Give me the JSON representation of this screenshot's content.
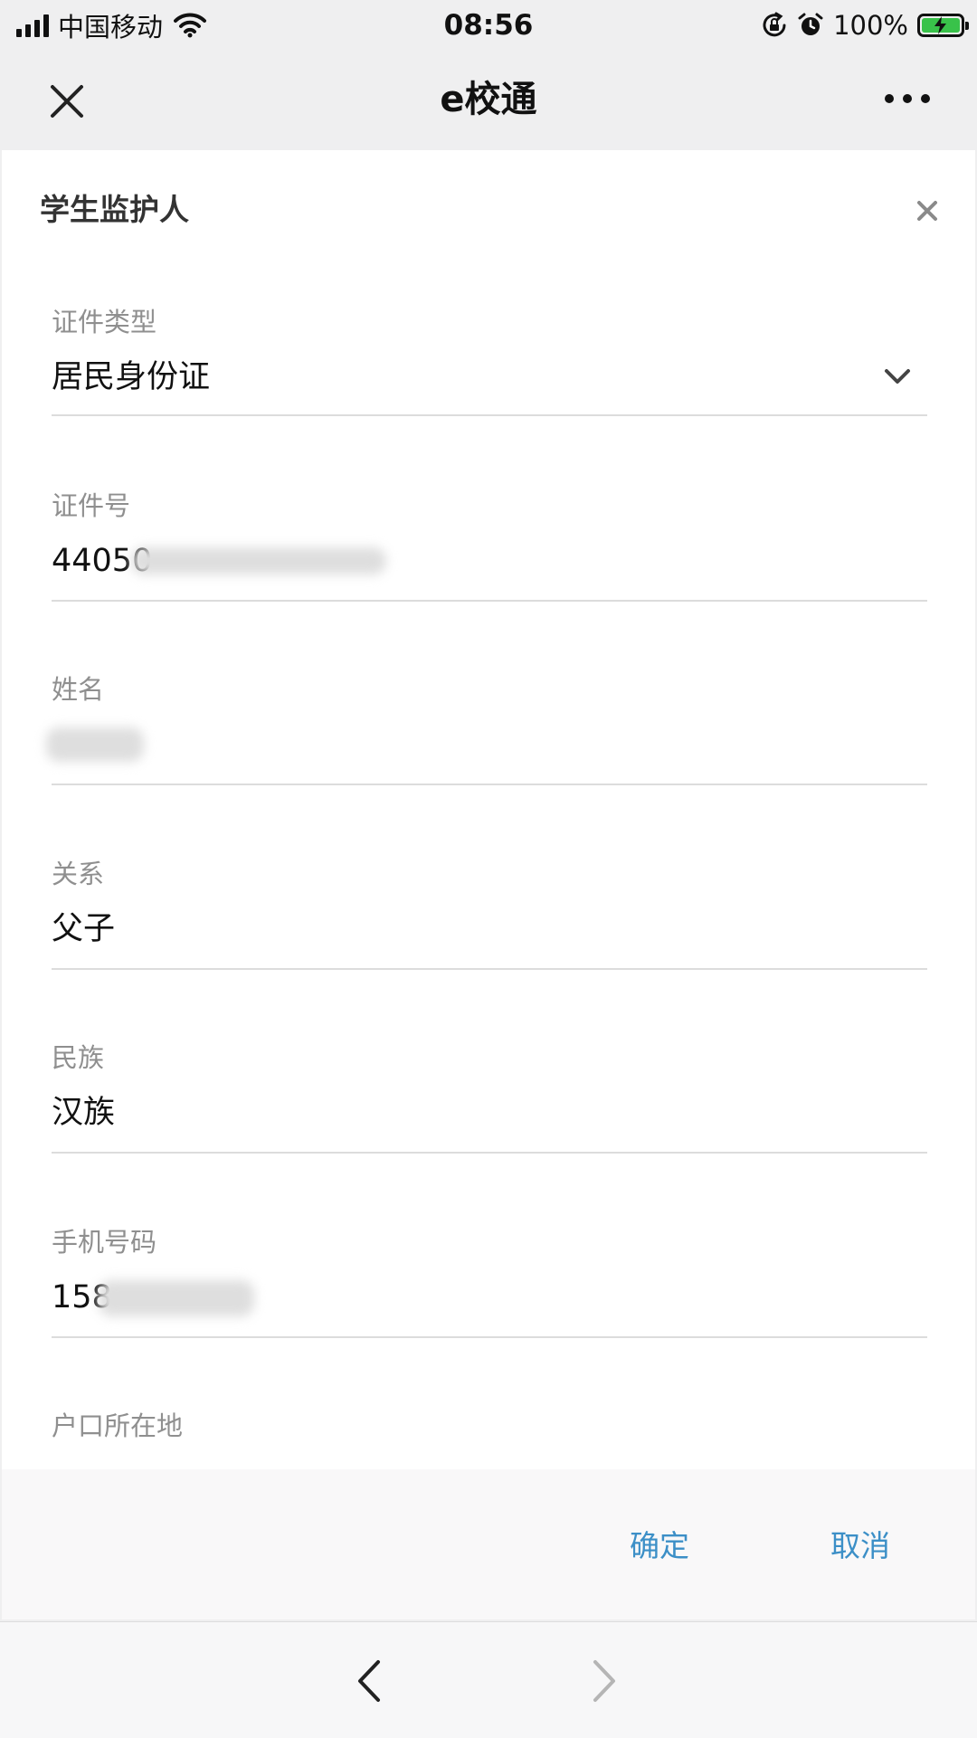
{
  "status_bar": {
    "carrier": "中国移动",
    "time": "08:56",
    "battery": "100%"
  },
  "nav": {
    "title": "e校通",
    "icons": [
      "close-icon",
      "more-icon"
    ]
  },
  "dialog": {
    "title": "学生监护人",
    "fields": [
      {
        "label": "证件类型",
        "value": "居民身份证"
      },
      {
        "label": "证件号",
        "value": "44050"
      },
      {
        "label": "姓名",
        "value": ""
      },
      {
        "label": "关系",
        "value": "父子"
      },
      {
        "label": "民族",
        "value": "汉族"
      },
      {
        "label": "手机号码",
        "value": "158"
      },
      {
        "label": "户口所在地",
        "value": ""
      }
    ],
    "confirm_label": "确定",
    "cancel_label": "取消"
  },
  "colors": {
    "accent": "#3c8fc7",
    "battery": "#39c24a",
    "label": "#8f8f8f"
  }
}
